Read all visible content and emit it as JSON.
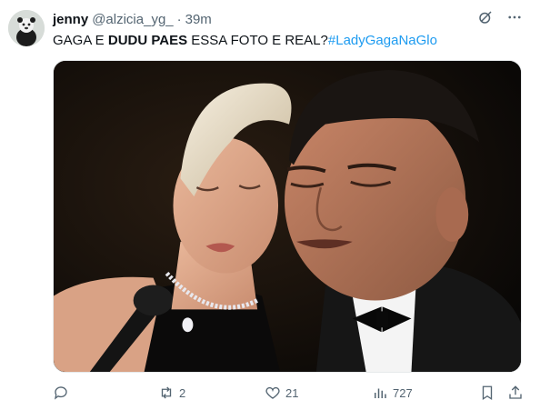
{
  "tweet": {
    "author_name": "jenny",
    "handle": "@alzicia_yg_",
    "separator": "·",
    "time": "39m",
    "text_parts": {
      "part1": "GAGA E ",
      "part2": "DUDU PAES",
      "part3": " ESSA FOTO E REAL?",
      "hashtag": "#LadyGagaNaGlo"
    },
    "media": {
      "description_icon": "photo"
    },
    "actions": {
      "reply_count": "",
      "retweet_count": "2",
      "like_count": "21",
      "views_count": "727"
    },
    "header_icons": [
      "grok-icon",
      "more-icon"
    ]
  },
  "colors": {
    "text_primary": "#0f1419",
    "text_secondary": "#536471",
    "link": "#1d9bf0"
  }
}
